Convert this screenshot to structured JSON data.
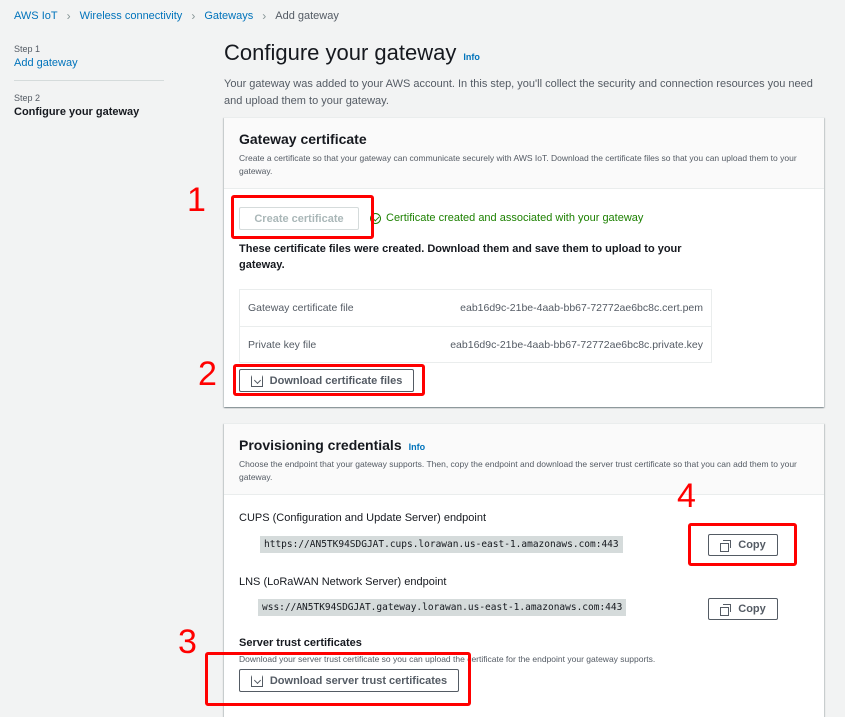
{
  "breadcrumb": [
    "AWS IoT",
    "Wireless connectivity",
    "Gateways",
    "Add gateway"
  ],
  "steps": [
    {
      "num": "Step 1",
      "title": "Add gateway"
    },
    {
      "num": "Step 2",
      "title": "Configure your gateway"
    }
  ],
  "page": {
    "title": "Configure your gateway",
    "info": "Info",
    "description": "Your gateway was added to your AWS account. In this step, you'll collect the security and connection resources you need and upload them to your gateway."
  },
  "certificate": {
    "title": "Gateway certificate",
    "description": "Create a certificate so that your gateway can communicate securely with AWS IoT. Download the certificate files so that you can upload them to your gateway.",
    "create_button": "Create certificate",
    "success": "Certificate created and associated with your gateway",
    "note": "These certificate files were created. Download them and save them to upload to your gateway.",
    "files": [
      {
        "label": "Gateway certificate file",
        "value": "eab16d9c-21be-4aab-bb67-72772ae6bc8c.cert.pem"
      },
      {
        "label": "Private key file",
        "value": "eab16d9c-21be-4aab-bb67-72772ae6bc8c.private.key"
      }
    ],
    "download_button": "Download certificate files"
  },
  "provisioning": {
    "title": "Provisioning credentials",
    "info": "Info",
    "description": "Choose the endpoint that your gateway supports. Then, copy the endpoint and download the server trust certificate so that you can add them to your gateway.",
    "cups_label": "CUPS (Configuration and Update Server) endpoint",
    "cups_value": "https://AN5TK94SDGJAT.cups.lorawan.us-east-1.amazonaws.com:443",
    "lns_label": "LNS (LoRaWAN Network Server) endpoint",
    "lns_value": "wss://AN5TK94SDGJAT.gateway.lorawan.us-east-1.amazonaws.com:443",
    "copy_label": "Copy",
    "trust_title": "Server trust certificates",
    "trust_description": "Download your server trust certificate so you can upload the certificate for the endpoint your gateway supports.",
    "trust_button": "Download server trust certificates"
  },
  "annotations": [
    "1",
    "2",
    "3",
    "4"
  ],
  "colors": {
    "link": "#0073bb",
    "success": "#1d8102",
    "annotation": "#ff0000"
  }
}
